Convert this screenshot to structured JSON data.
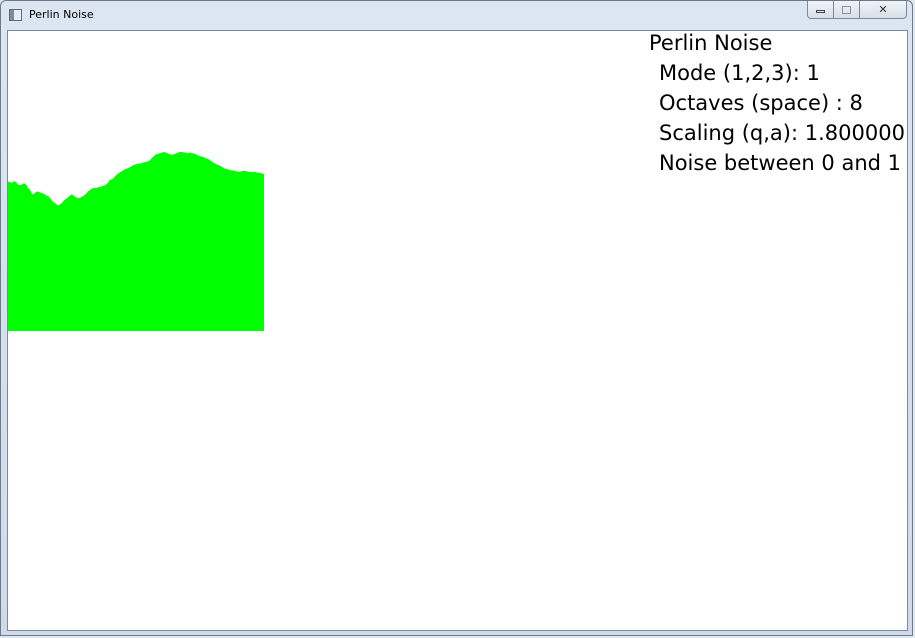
{
  "window": {
    "title": "Perlin Noise",
    "min_icon": "minimize-icon",
    "max_icon": "maximize-icon",
    "close_icon": "close-icon",
    "close_glyph": "✕"
  },
  "hud": {
    "heading": "Perlin Noise",
    "mode": "Mode (1,2,3): 1",
    "octaves": "Octaves (space) : 8",
    "scaling": "Scaling (q,a): 1.800000",
    "range": "Noise between 0 and 1"
  },
  "noise": {
    "fill_color": "#00ff00",
    "samples": [
      0.49,
      0.48,
      0.47,
      0.5,
      0.48,
      0.44,
      0.43,
      0.44,
      0.46,
      0.44,
      0.38,
      0.35,
      0.27,
      0.28,
      0.31,
      0.32,
      0.3,
      0.29,
      0.28,
      0.25,
      0.24,
      0.21,
      0.16,
      0.13,
      0.1,
      0.08,
      0.1,
      0.12,
      0.17,
      0.19,
      0.22,
      0.25,
      0.27,
      0.24,
      0.22,
      0.2,
      0.21,
      0.23,
      0.25,
      0.28,
      0.32,
      0.35,
      0.37,
      0.38,
      0.38,
      0.39,
      0.4,
      0.41,
      0.42,
      0.44,
      0.47,
      0.52,
      0.53,
      0.56,
      0.6,
      0.63,
      0.65,
      0.67,
      0.69,
      0.71,
      0.72,
      0.74,
      0.76,
      0.78,
      0.79,
      0.8,
      0.8,
      0.81,
      0.82,
      0.83,
      0.84,
      0.86,
      0.9,
      0.93,
      0.96,
      0.97,
      0.98,
      0.99,
      1.0,
      0.99,
      0.97,
      0.96,
      0.95,
      0.96,
      0.98,
      0.99,
      1.0,
      1.0,
      0.99,
      0.99,
      0.98,
      0.99,
      0.98,
      0.97,
      0.96,
      0.94,
      0.93,
      0.92,
      0.91,
      0.89,
      0.88,
      0.86,
      0.83,
      0.81,
      0.79,
      0.78,
      0.76,
      0.74,
      0.72,
      0.71,
      0.7,
      0.69,
      0.68,
      0.68,
      0.67,
      0.66,
      0.66,
      0.67,
      0.68,
      0.67,
      0.66,
      0.66,
      0.65,
      0.66,
      0.65,
      0.64,
      0.64,
      0.63,
      0.62
    ]
  }
}
